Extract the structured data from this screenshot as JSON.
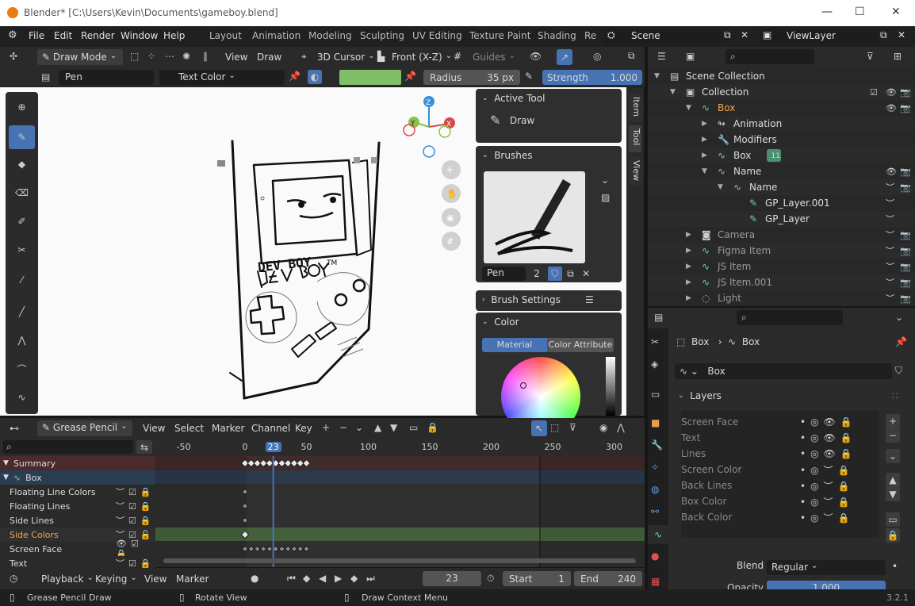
{
  "title": "Blender* [C:\\Users\\Kevin\\Documents\\gameboy.blend]",
  "menu": [
    "File",
    "Edit",
    "Render",
    "Window",
    "Help"
  ],
  "workspaces": [
    "Layout",
    "Animation",
    "Modeling",
    "Sculpting",
    "UV Editing",
    "Texture Paint",
    "Shading",
    "Re"
  ],
  "scene": "Scene",
  "viewlayer": "ViewLayer",
  "viewport_header": {
    "mode": "Draw Mode",
    "view": "View",
    "draw": "Draw",
    "cursor": "3D Cursor",
    "view_axis": "Front (X-Z)",
    "guides": "Guides"
  },
  "toolsettings": {
    "brush": "Pen",
    "color_mode": "Text Color",
    "radius_label": "Radius",
    "radius_value": "35 px",
    "strength_label": "Strength",
    "strength_value": "1.000",
    "color": "#7fbf6a"
  },
  "sidebar_tabs": [
    "Item",
    "Tool",
    "View"
  ],
  "active_tool": {
    "header": "Active Tool",
    "tool": "Draw"
  },
  "brushes": {
    "header": "Brushes",
    "name": "Pen",
    "users": "2"
  },
  "brush_settings": "Brush Settings",
  "color_panel": {
    "header": "Color",
    "tab_material": "Material",
    "tab_attribute": "Color Attribute"
  },
  "outliner": {
    "rows": [
      {
        "label": "Scene Collection",
        "indent": 0
      },
      {
        "label": "Collection",
        "indent": 1
      },
      {
        "label": "Box",
        "indent": 2,
        "orange": true
      },
      {
        "label": "Animation",
        "indent": 3
      },
      {
        "label": "Modifiers",
        "indent": 3
      },
      {
        "label": "Box",
        "indent": 3,
        "badge": "11"
      },
      {
        "label": "Name",
        "indent": 3
      },
      {
        "label": "Name",
        "indent": 4
      },
      {
        "label": "GP_Layer.001",
        "indent": 5
      },
      {
        "label": "GP_Layer",
        "indent": 5
      },
      {
        "label": "Camera",
        "indent": 2,
        "dim": true
      },
      {
        "label": "Figma Item",
        "indent": 2,
        "dim": true
      },
      {
        "label": "JS Item",
        "indent": 2,
        "dim": true
      },
      {
        "label": "JS Item.001",
        "indent": 2,
        "dim": true
      },
      {
        "label": "Light",
        "indent": 2,
        "dim": true
      }
    ]
  },
  "properties": {
    "breadcrumb_object": "Box",
    "breadcrumb_data": "Box",
    "data_name": "Box",
    "layers_header": "Layers",
    "layers": [
      "Screen Face",
      "Text",
      "Lines",
      "Screen Color",
      "Back Lines",
      "Box Color",
      "Back Color"
    ],
    "blend_label": "Blend",
    "blend_value": "Regular",
    "opacity_label": "Opacity",
    "opacity_value": "1.000"
  },
  "dopesheet": {
    "mode": "Grease Pencil",
    "menus": [
      "View",
      "Select",
      "Marker",
      "Channel",
      "Key"
    ],
    "ruler": [
      "-50",
      "0",
      "23",
      "50",
      "100",
      "150",
      "200",
      "250",
      "300"
    ],
    "channels": [
      "Summary",
      "Box",
      "Floating Line Colors",
      "Floating Lines",
      "Side Lines",
      "Side Colors",
      "Screen Face",
      "Text"
    ]
  },
  "timeline": {
    "playback": "Playback",
    "keying": "Keying",
    "view": "View",
    "marker": "Marker",
    "frame": "23",
    "start_label": "Start",
    "start": "1",
    "end_label": "End",
    "end": "240"
  },
  "status": {
    "a": "Grease Pencil Draw",
    "b": "Rotate View",
    "c": "Draw Context Menu",
    "version": "3.2.1"
  },
  "sketch": {
    "brand": "DEV BOY",
    "tm": "TM"
  }
}
